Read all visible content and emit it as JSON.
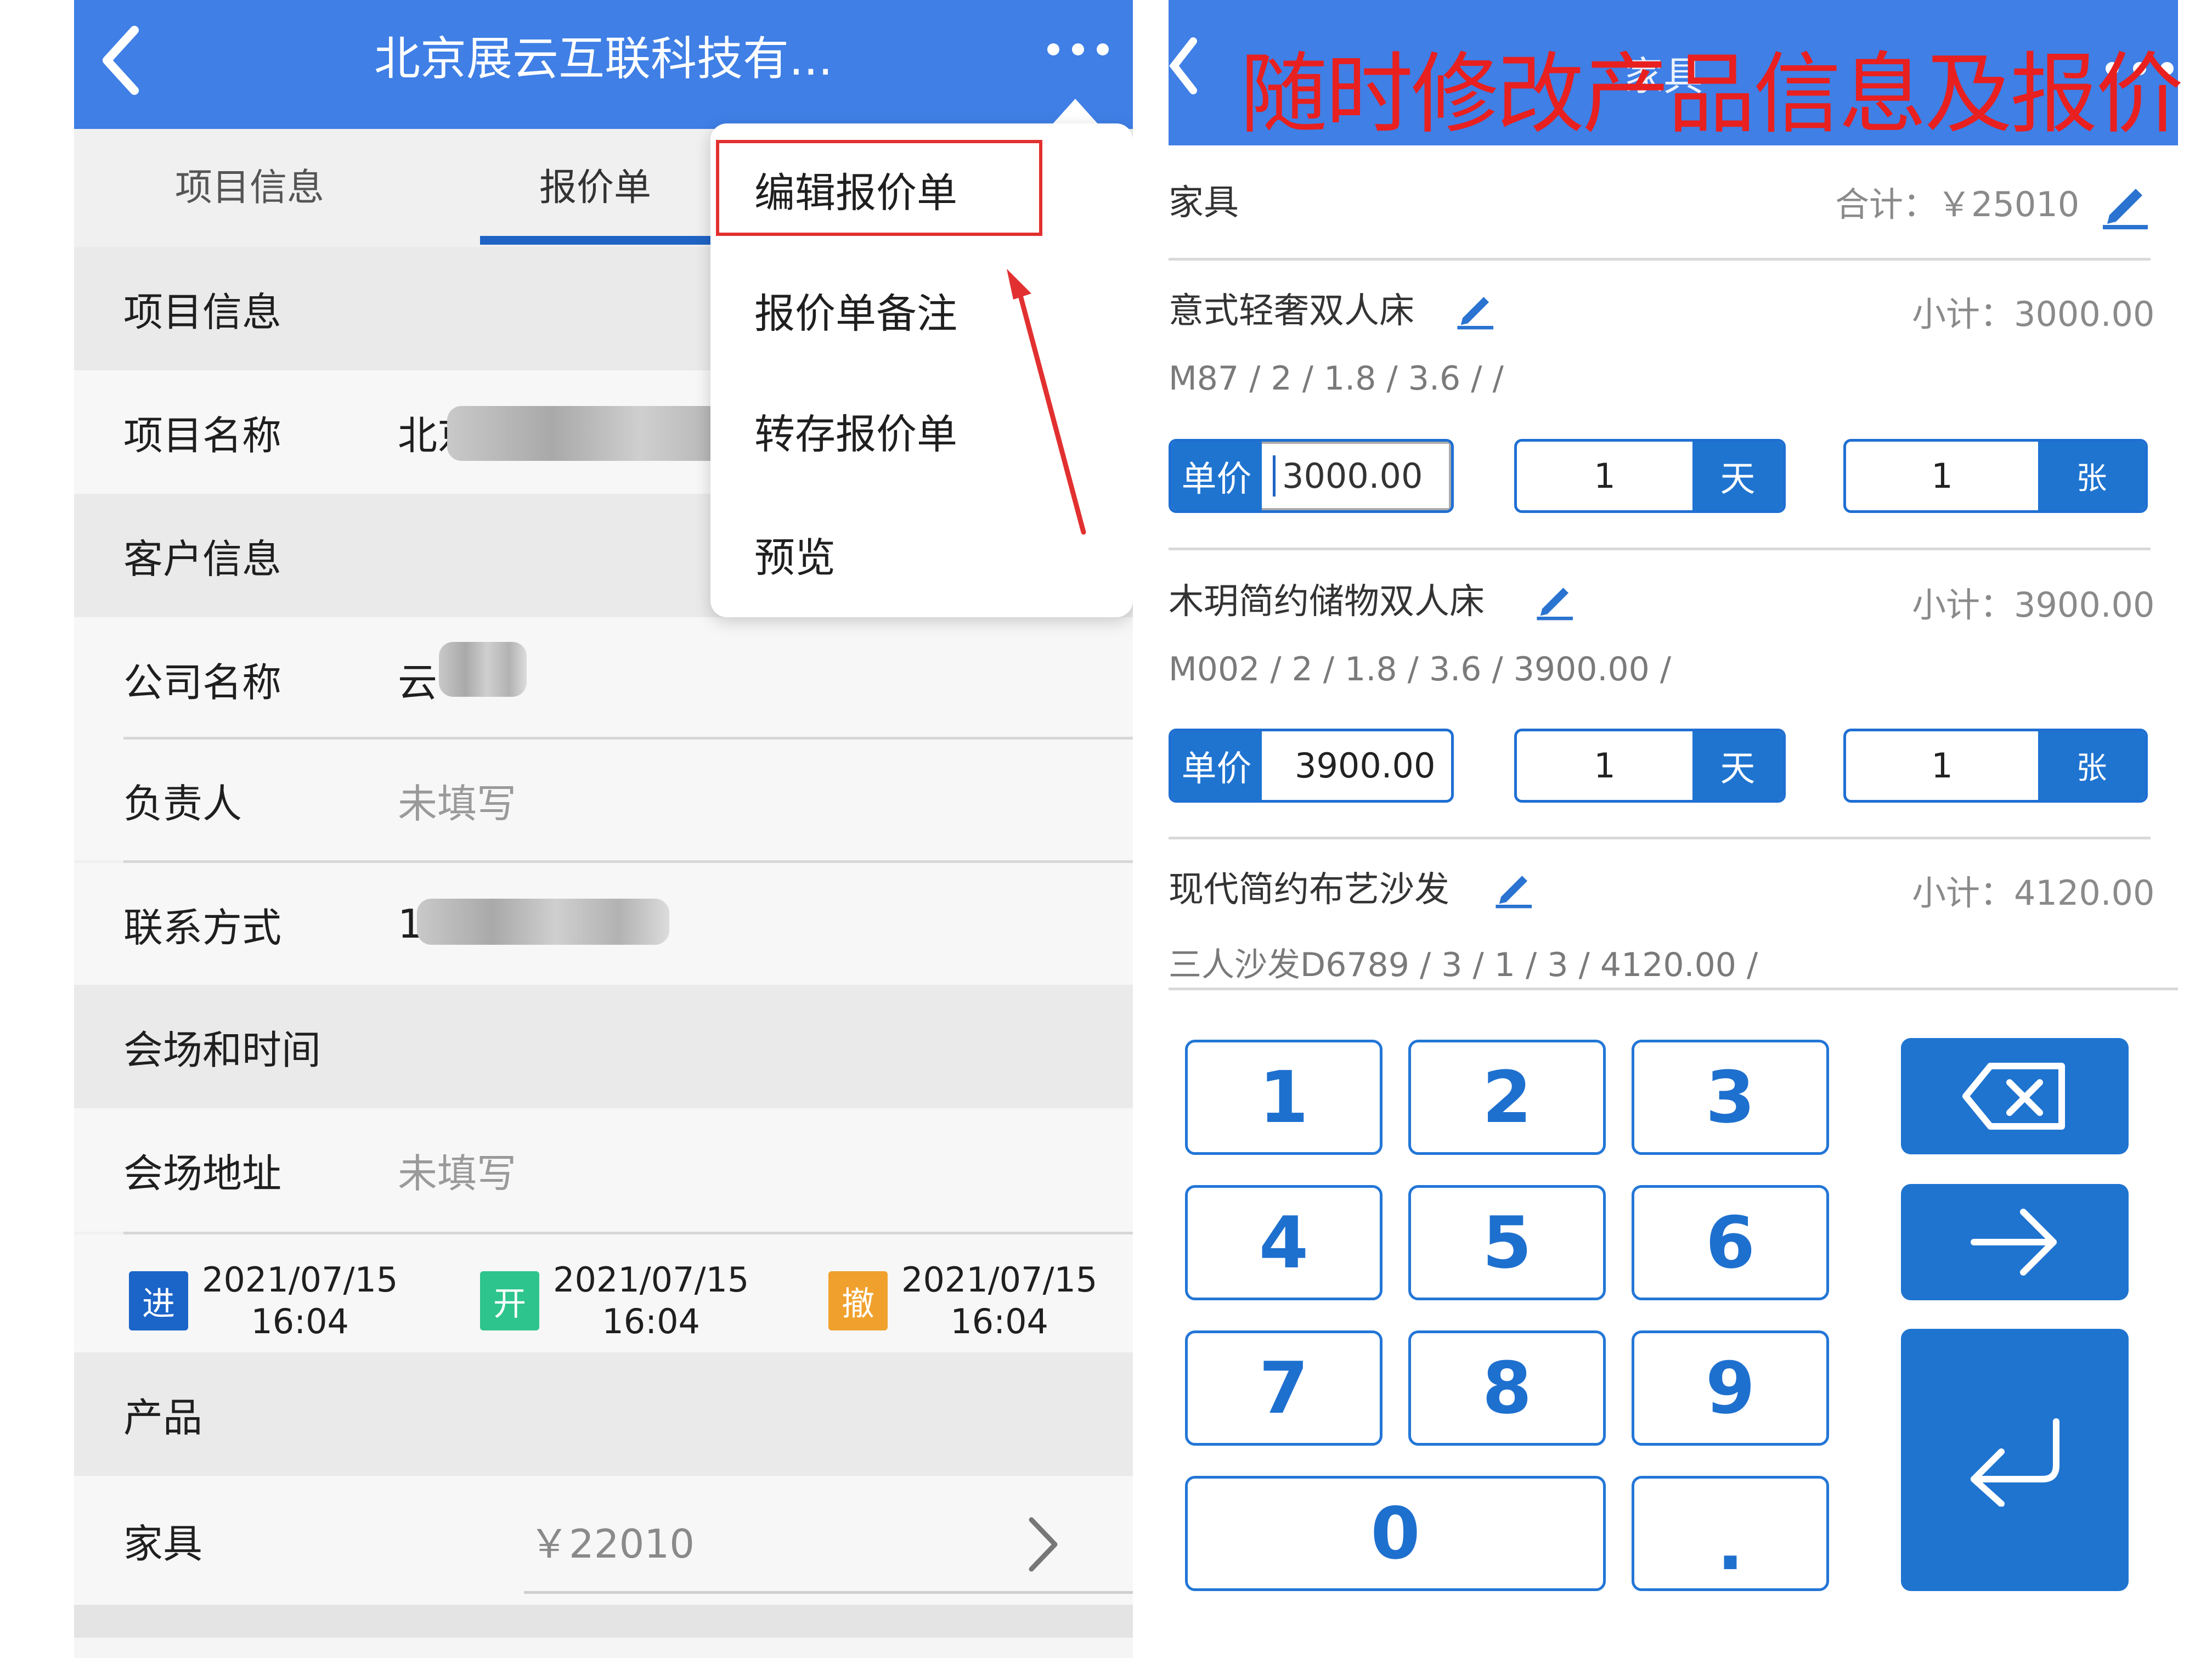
{
  "left": {
    "header": {
      "title": "北京展云互联科技有..."
    },
    "tabs": [
      "项目信息",
      "报价单"
    ],
    "menu": [
      "编辑报价单",
      "报价单备注",
      "转存报价单",
      "预览"
    ],
    "sections": {
      "project": "项目信息",
      "customer": "客户信息",
      "venue_time": "会场和时间",
      "products": "产品"
    },
    "fields": {
      "project_name": {
        "label": "项目名称",
        "value_visible": "北京"
      },
      "company_name": {
        "label": "公司名称",
        "value_visible": "云"
      },
      "person": {
        "label": "负责人",
        "value": "未填写"
      },
      "contact": {
        "label": "联系方式",
        "value_visible": "1"
      },
      "venue": {
        "label": "会场地址",
        "value": "未填写"
      }
    },
    "dates": [
      {
        "badge": "进",
        "date": "2021/07/15",
        "time": "16:04",
        "color": "#1b64c8"
      },
      {
        "badge": "开",
        "date": "2021/07/15",
        "time": "16:04",
        "color": "#2ec48e"
      },
      {
        "badge": "撤",
        "date": "2021/07/15",
        "time": "16:04",
        "color": "#f0a12d"
      }
    ],
    "product_row": {
      "label": "家具",
      "amount": "￥22010"
    }
  },
  "right": {
    "header": {
      "overlay_title": "随时修改产品信息及报价",
      "behind_text": "家具"
    },
    "category": {
      "name": "家具",
      "total": "合计：￥25010"
    },
    "items": [
      {
        "name": "意式轻奢双人床",
        "subtotal": "小计：3000.00",
        "spec": "M87 / 2 / 1.8 / 3.6 / /",
        "price_label": "单价",
        "price": "3000.00",
        "qty": "1",
        "qty_unit": "天",
        "count": "1",
        "count_unit": "张"
      },
      {
        "name": "木玥简约储物双人床",
        "subtotal": "小计：3900.00",
        "spec": "M002 / 2 / 1.8 / 3.6 / 3900.00 /",
        "price_label": "单价",
        "price": "3900.00",
        "qty": "1",
        "qty_unit": "天",
        "count": "1",
        "count_unit": "张"
      },
      {
        "name": "现代简约布艺沙发",
        "subtotal": "小计：4120.00",
        "spec": "三人沙发D6789 / 3 / 1 / 3 / 4120.00 /"
      }
    ],
    "keypad": [
      "1",
      "2",
      "3",
      "4",
      "5",
      "6",
      "7",
      "8",
      "9",
      "0",
      "."
    ]
  },
  "colors": {
    "primary": "#3f7fe6",
    "accent": "#1f74d0",
    "highlight": "#e23030"
  },
  "icons": [
    "back-icon",
    "more-icon",
    "chevron-right-icon",
    "edit-pencil-icon",
    "backspace-icon",
    "arrow-right-icon",
    "enter-icon"
  ]
}
